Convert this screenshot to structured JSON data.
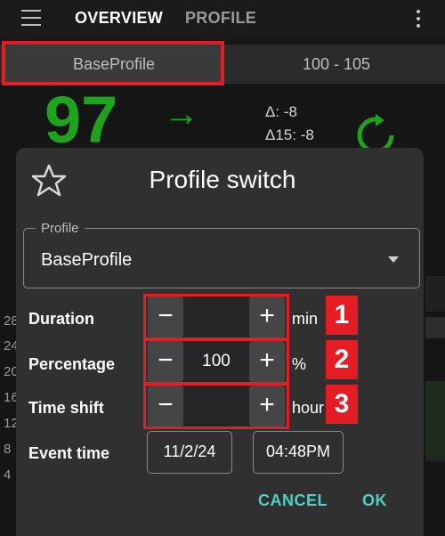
{
  "appbar": {
    "tabs": [
      {
        "label": "OVERVIEW",
        "active": true
      },
      {
        "label": "PROFILE",
        "active": false
      }
    ]
  },
  "profile_bar": {
    "active_profile": "BaseProfile",
    "target_range": "100 - 105"
  },
  "overview": {
    "bg_value": "97",
    "trend_arrow": "→",
    "delta": "Δ: -8",
    "delta15": "Δ15: -8",
    "axis_ticks": [
      "28",
      "24",
      "20",
      "16",
      "12",
      "8",
      "4"
    ]
  },
  "dialog": {
    "title": "Profile switch",
    "profile_label": "Profile",
    "profile_value": "BaseProfile",
    "duration": {
      "label": "Duration",
      "value": "",
      "unit": "min",
      "badge": "1"
    },
    "percentage": {
      "label": "Percentage",
      "value": "100",
      "unit": "%",
      "badge": "2"
    },
    "timeshift": {
      "label": "Time shift",
      "value": "",
      "unit": "hour",
      "badge": "3"
    },
    "event_time": {
      "label": "Event time",
      "date": "11/2/24",
      "time": "04:48PM"
    },
    "cancel_label": "CANCEL",
    "ok_label": "OK"
  },
  "colors": {
    "accent_teal": "#4dd0c1",
    "highlight_red": "#e51c23",
    "bg_green": "#1fa31f"
  },
  "icons": [
    "hamburger-icon",
    "more-vert-icon",
    "trend-arrow-icon",
    "refresh-icon",
    "star-outline-icon",
    "dropdown-caret-icon",
    "minus-icon",
    "plus-icon"
  ]
}
